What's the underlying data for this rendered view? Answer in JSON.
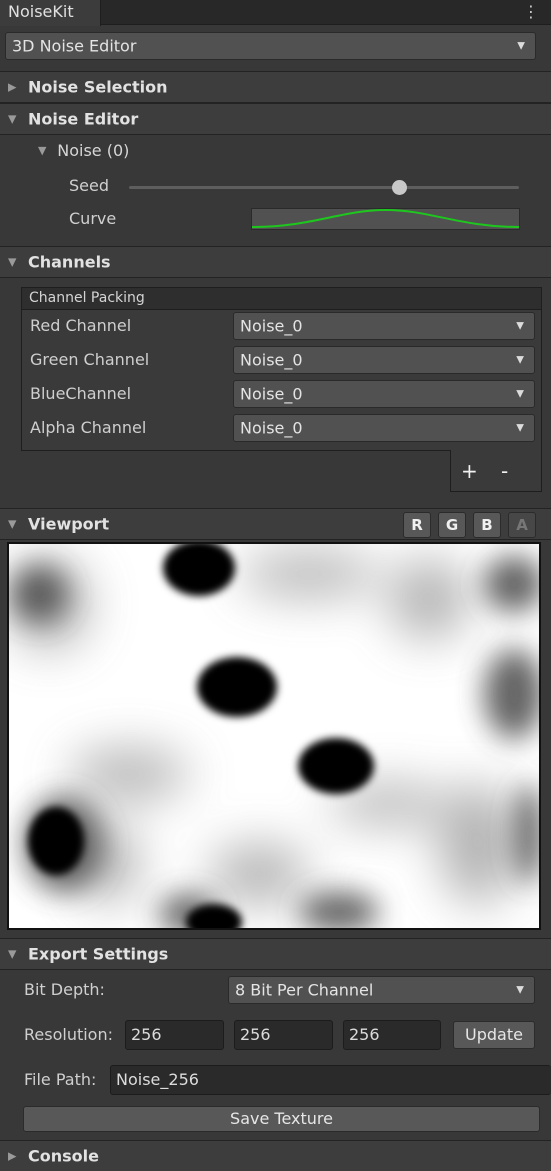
{
  "window": {
    "tab_title": "NoiseKit",
    "menu_icon": "kebab-icon"
  },
  "editor_mode": {
    "selected": "3D Noise Editor"
  },
  "sections": {
    "noise_selection": "Noise Selection",
    "noise_editor": "Noise Editor",
    "channels": "Channels",
    "viewport": "Viewport",
    "export_settings": "Export Settings",
    "console": "Console"
  },
  "noise_editor": {
    "noise_item": "Noise (0)",
    "seed_label": "Seed",
    "seed_value_fraction": 0.7,
    "curve_label": "Curve",
    "curve_color": "#1ec71e"
  },
  "channels": {
    "group_title": "Channel Packing",
    "rows": [
      {
        "label": "Red Channel",
        "value": "Noise_0"
      },
      {
        "label": "Green Channel",
        "value": "Noise_0"
      },
      {
        "label": "BlueChannel",
        "value": "Noise_0"
      },
      {
        "label": "Alpha Channel",
        "value": "Noise_0"
      }
    ],
    "add_label": "+",
    "remove_label": "-"
  },
  "viewport": {
    "channel_buttons": [
      {
        "label": "R",
        "active": true
      },
      {
        "label": "G",
        "active": true
      },
      {
        "label": "B",
        "active": true
      },
      {
        "label": "A",
        "active": false
      }
    ]
  },
  "export": {
    "bit_depth_label": "Bit Depth:",
    "bit_depth_value": "8 Bit Per Channel",
    "resolution_label": "Resolution:",
    "resolution": [
      "256",
      "256",
      "256"
    ],
    "update_label": "Update",
    "file_path_label": "File Path:",
    "file_path_value": "Noise_256",
    "save_label": "Save Texture"
  }
}
